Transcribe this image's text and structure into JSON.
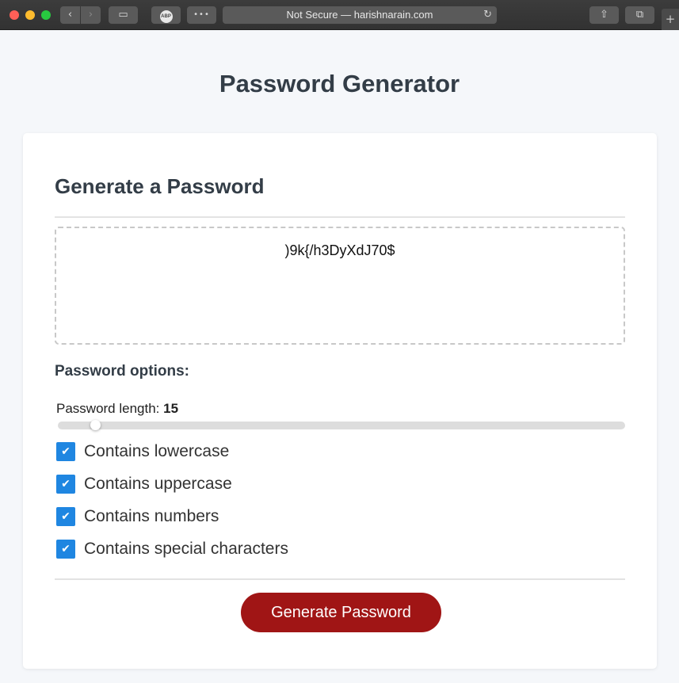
{
  "browser": {
    "url_text": "Not Secure — harishnarain.com",
    "back_icon": "‹",
    "forward_icon": "›",
    "sidebar_icon": "▭",
    "abp_label": "ABP",
    "more_icon": "•••",
    "reload_icon": "↻",
    "share_icon": "⇧",
    "tabs_icon": "⧉",
    "newtab_icon": "+"
  },
  "page": {
    "title": "Password Generator"
  },
  "generator": {
    "heading": "Generate a Password",
    "password": ")9k{/h3DyXdJ70$",
    "options_heading": "Password options:",
    "length_label": "Password length: ",
    "length_value": "15",
    "slider_fraction": 0.065,
    "check_glyph": "✔",
    "options": [
      {
        "label": "Contains lowercase",
        "checked": true
      },
      {
        "label": "Contains uppercase",
        "checked": true
      },
      {
        "label": "Contains numbers",
        "checked": true
      },
      {
        "label": "Contains special characters",
        "checked": true
      }
    ],
    "button_label": "Generate Password"
  },
  "colors": {
    "accent_checkbox": "#1f86e1",
    "button_bg": "#a01515",
    "title_text": "#333d47"
  }
}
